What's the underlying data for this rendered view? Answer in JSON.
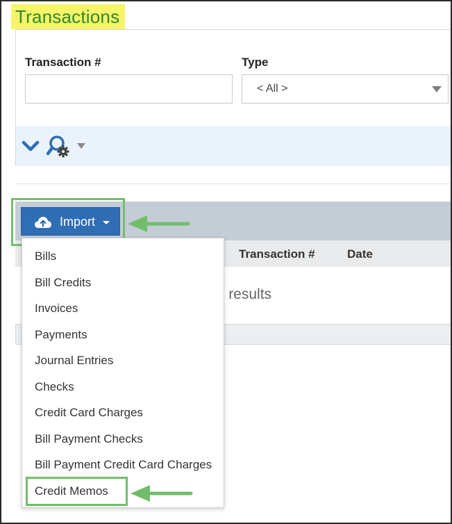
{
  "page": {
    "title": "Transactions"
  },
  "filters": {
    "transaction_label": "Transaction #",
    "transaction_value": "",
    "type_label": "Type",
    "type_value": "< All >"
  },
  "toolbar": {
    "icons": [
      "chevron-down-icon",
      "search-settings-icon",
      "caret-down-icon"
    ]
  },
  "grid": {
    "columns": [
      "Transaction #",
      "Date"
    ],
    "empty_message": "he results"
  },
  "import": {
    "label": "Import",
    "icon": "cloud-upload-icon",
    "menu_items": [
      "Bills",
      "Bill Credits",
      "Invoices",
      "Payments",
      "Journal Entries",
      "Checks",
      "Credit Card Charges",
      "Bill Payment Checks",
      "Bill Payment Credit Card Charges",
      "Credit Memos"
    ]
  },
  "colors": {
    "title_highlight": "#f6f56a",
    "title_text": "#2f8a2f",
    "import_button": "#2f6db5",
    "annotation_green": "#72bd6a",
    "icon_blue": "#2f6db5"
  }
}
